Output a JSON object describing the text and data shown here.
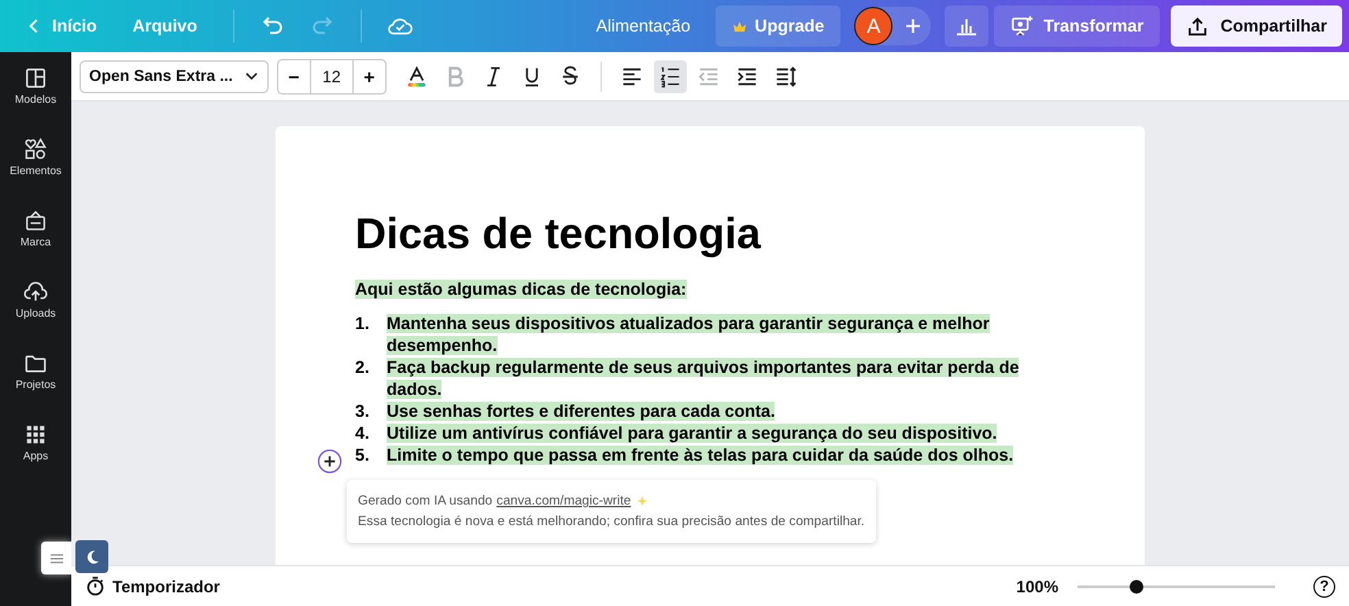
{
  "topbar": {
    "home": "Início",
    "file_menu": "Arquivo",
    "redo_disabled": true,
    "design_title": "Alimentação",
    "upgrade": "Upgrade",
    "avatar": "A",
    "transform": "Transformar",
    "share": "Compartilhar"
  },
  "sidebar": [
    {
      "label": "Modelos"
    },
    {
      "label": "Elementos"
    },
    {
      "label": "Marca"
    },
    {
      "label": "Uploads"
    },
    {
      "label": "Projetos"
    },
    {
      "label": "Apps"
    }
  ],
  "toolbar": {
    "font": "Open Sans Extra ...",
    "minus": "−",
    "size": "12",
    "plus": "+",
    "tools": [
      {
        "kind": "color",
        "disabled": false,
        "selected": false
      },
      {
        "kind": "bold",
        "disabled": true,
        "selected": false
      },
      {
        "kind": "italic",
        "disabled": false,
        "selected": false
      },
      {
        "kind": "underline",
        "disabled": false,
        "selected": false
      },
      {
        "kind": "strike",
        "disabled": false,
        "selected": false
      },
      {
        "kind": "align",
        "disabled": false,
        "selected": false
      },
      {
        "kind": "numbered",
        "disabled": false,
        "selected": true
      },
      {
        "kind": "outdent",
        "disabled": true,
        "selected": false
      },
      {
        "kind": "indent",
        "disabled": false,
        "selected": false
      },
      {
        "kind": "spacing",
        "disabled": false,
        "selected": false
      }
    ]
  },
  "document": {
    "title": "Dicas de tecnologia",
    "intro": "Aqui estão algumas dicas de tecnologia:",
    "highlighted": true,
    "items": [
      {
        "number": "1.",
        "text": "Mantenha seus dispositivos atualizados para garantir segurança e melhor desempenho."
      },
      {
        "number": "2.",
        "text": "Faça backup regularmente de seus arquivos importantes para evitar perda de dados."
      },
      {
        "number": "3.",
        "text": "Use senhas fortes e diferentes para cada conta."
      },
      {
        "number": "4.",
        "text": "Utilize um antivírus confiável para garantir a segurança do seu dispositivo."
      },
      {
        "number": "5.",
        "text": "Limite o tempo que passa em frente às telas para cuidar da saúde dos olhos."
      }
    ]
  },
  "ai_note": {
    "prefix": "Gerado com IA usando",
    "link": "canva.com/magic-write",
    "line2": "Essa tecnologia é nova e está melhorando; confira sua precisão antes de compartilhar."
  },
  "bottombar": {
    "timer": "Temporizador",
    "zoom": "100%",
    "level": 0.3,
    "help": "?"
  }
}
